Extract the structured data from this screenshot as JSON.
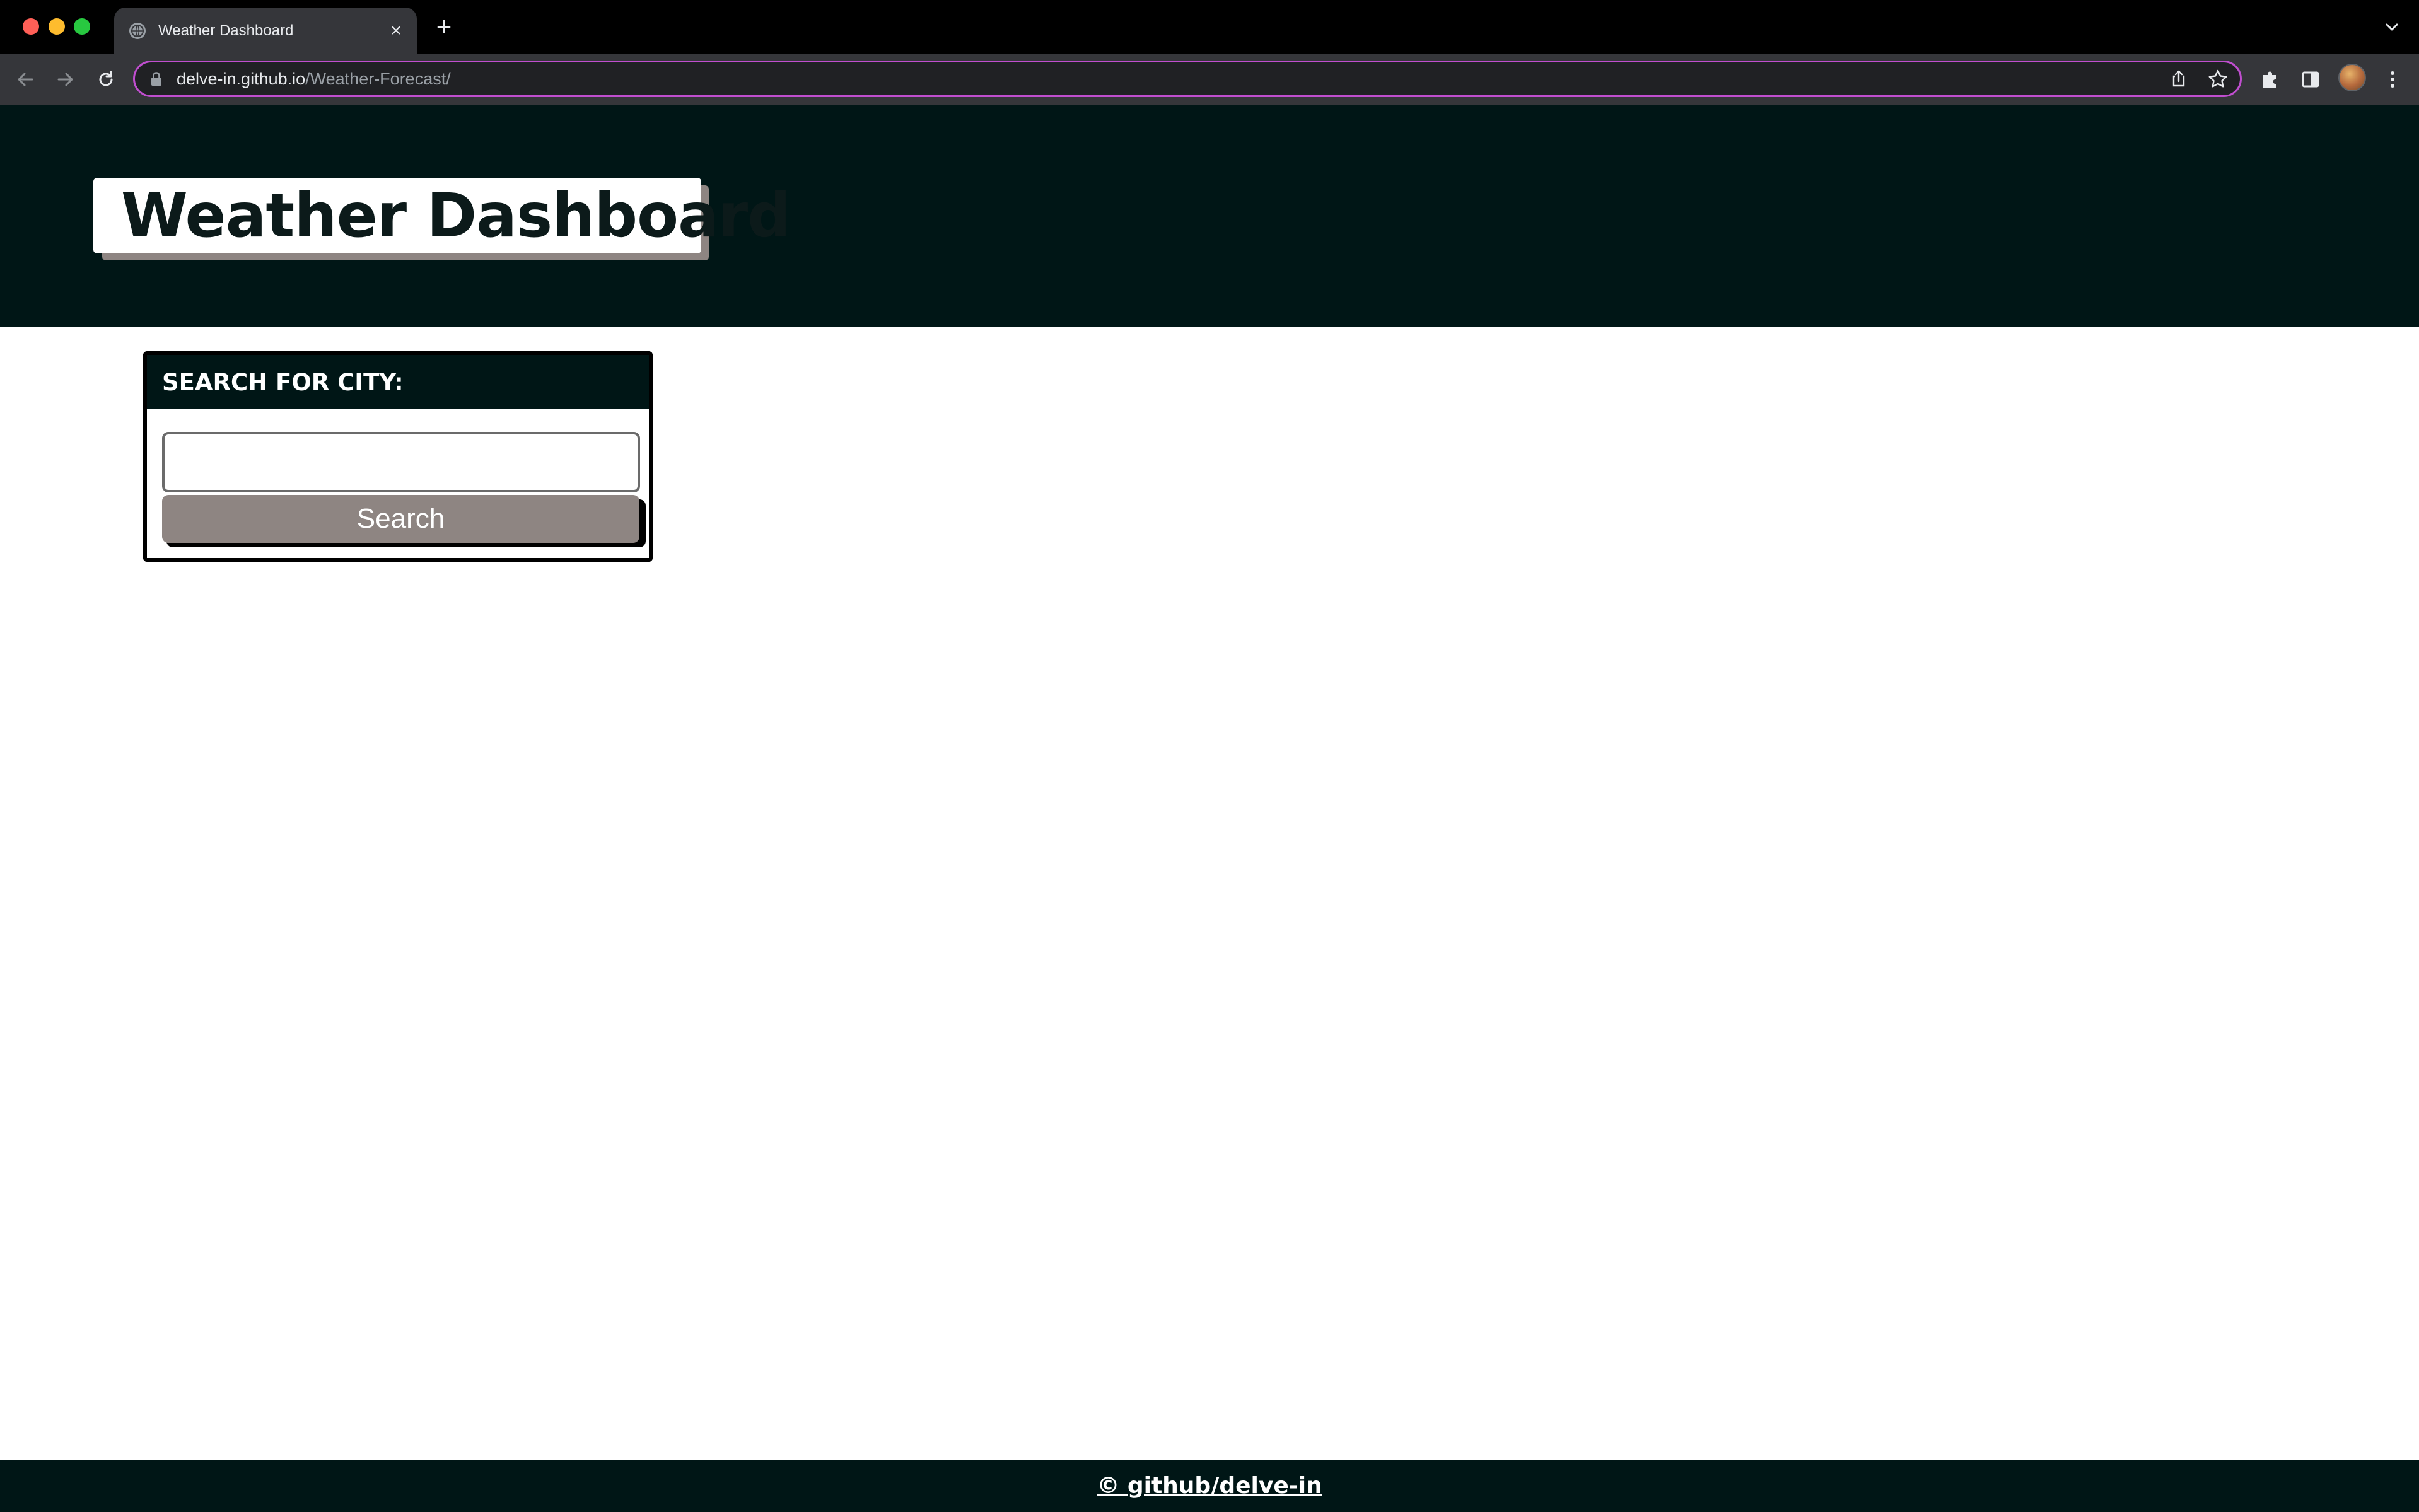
{
  "browser": {
    "tab": {
      "title": "Weather Dashboard"
    },
    "address_bar": {
      "domain": "delve-in.github.io",
      "path": "/Weather-Forecast/"
    }
  },
  "header": {
    "title": "Weather Dashboard"
  },
  "search": {
    "heading": "SEARCH FOR CITY:",
    "input_value": "",
    "button_label": "Search"
  },
  "footer": {
    "link_text": "© github/delve-in"
  },
  "colors": {
    "header_bg": "#001616",
    "button_bg": "#8e8582",
    "omnibox_focus": "#c04ecf"
  }
}
